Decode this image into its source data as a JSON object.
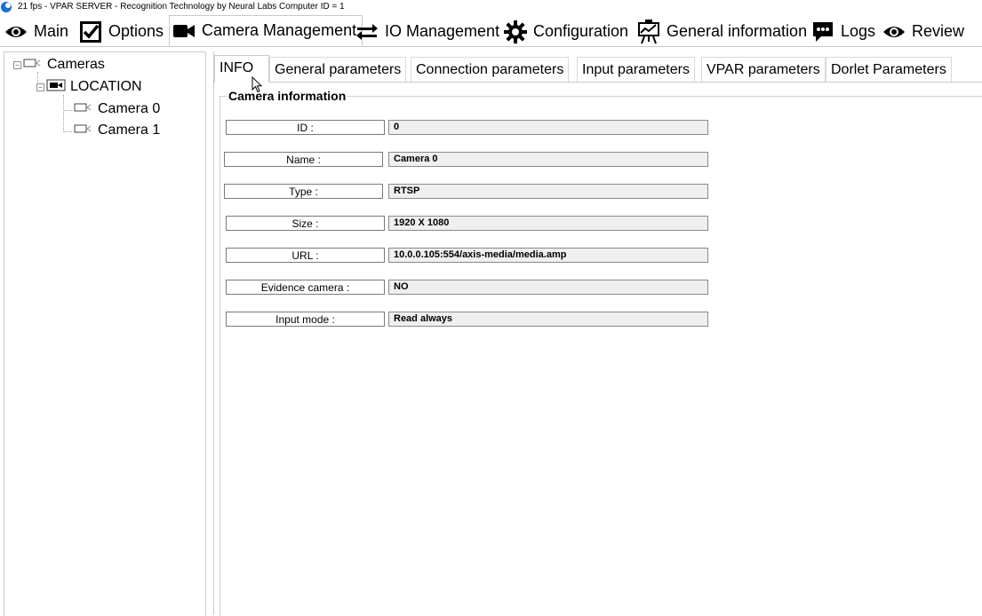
{
  "window": {
    "title": "21 fps - VPAR SERVER - Recognition Technology by Neural Labs Computer ID  = 1"
  },
  "main_tabs": [
    {
      "label": "Main",
      "icon": "eye-icon"
    },
    {
      "label": "Options",
      "icon": "checkbox-icon"
    },
    {
      "label": "Camera Management",
      "icon": "video-camera-icon",
      "active": true
    },
    {
      "label": "IO Management",
      "icon": "swap-arrows-icon"
    },
    {
      "label": "Configuration",
      "icon": "gear-icon"
    },
    {
      "label": "General information",
      "icon": "presentation-chart-icon"
    },
    {
      "label": "Logs",
      "icon": "chat-bubble-icon"
    },
    {
      "label": "Review",
      "icon": "eye-icon"
    }
  ],
  "tree": {
    "root": "Cameras",
    "location": "LOCATION",
    "cameras": [
      "Camera 0",
      "Camera 1"
    ]
  },
  "sub_tabs": [
    {
      "label": "INFO",
      "active": true
    },
    {
      "label": "General parameters"
    },
    {
      "label": "Connection parameters"
    },
    {
      "label": "Input parameters"
    },
    {
      "label": "VPAR parameters"
    },
    {
      "label": "Dorlet Parameters"
    }
  ],
  "camera_info": {
    "group_title": "Camera information",
    "fields": [
      {
        "label": "ID :",
        "value": "0"
      },
      {
        "label": "Name :",
        "value": "Camera 0"
      },
      {
        "label": "Type :",
        "value": "RTSP"
      },
      {
        "label": "Size :",
        "value": "1920 X 1080"
      },
      {
        "label": "URL :",
        "value": "10.0.0.105:554/axis-media/media.amp"
      },
      {
        "label": "Evidence camera :",
        "value": "NO"
      },
      {
        "label": "Input mode :",
        "value": "Read always"
      }
    ]
  },
  "colors": {
    "field_bg": "#efefef",
    "border": "#c9c9c9",
    "app_icon": "#1a6fd1"
  }
}
